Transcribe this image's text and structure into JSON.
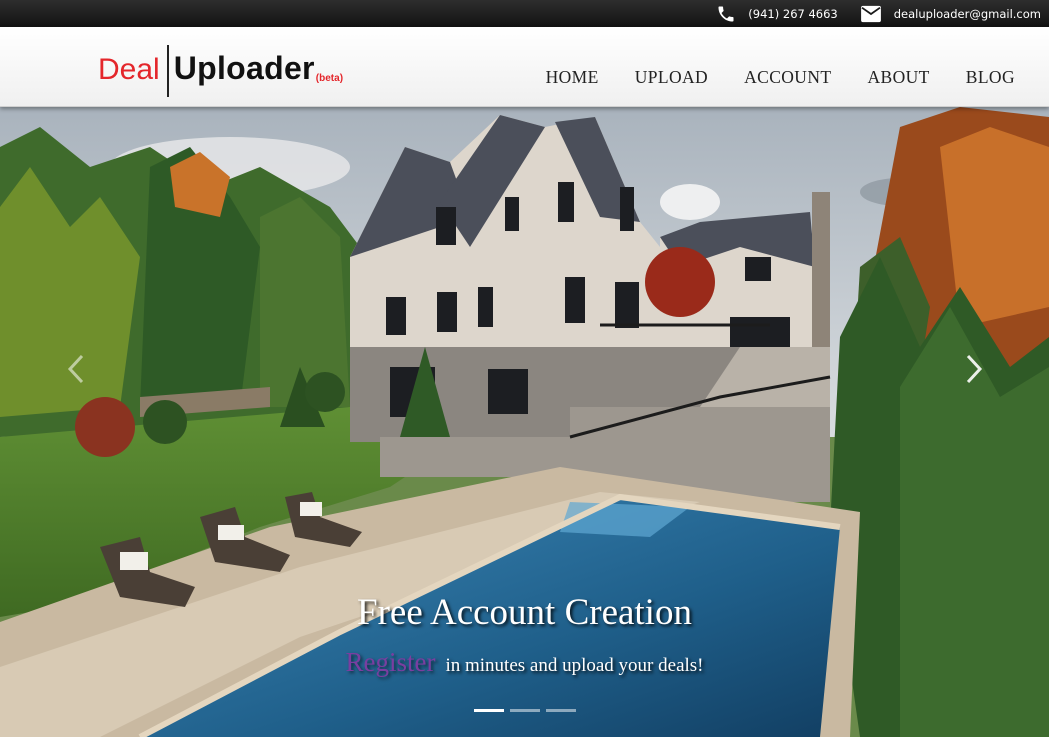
{
  "topbar": {
    "phone": "(941) 267 4663",
    "email": "dealuploader@gmail.com",
    "phone_icon": "phone-icon",
    "email_icon": "envelope-icon"
  },
  "logo": {
    "deal": "Deal",
    "uploader": "Uploader",
    "beta": "(beta)",
    "deal_color": "#e4262b"
  },
  "nav": {
    "items": [
      "HOME",
      "UPLOAD",
      "ACCOUNT",
      "ABOUT",
      "BLOG"
    ]
  },
  "hero": {
    "title": "Free Account Creation",
    "register_link": "Register",
    "subtitle": "in minutes and upload your deals!",
    "register_color": "#7a3ea0",
    "slide_count": 3,
    "active_slide": 1,
    "prev_icon": "chevron-left-icon",
    "next_icon": "chevron-right-icon"
  }
}
